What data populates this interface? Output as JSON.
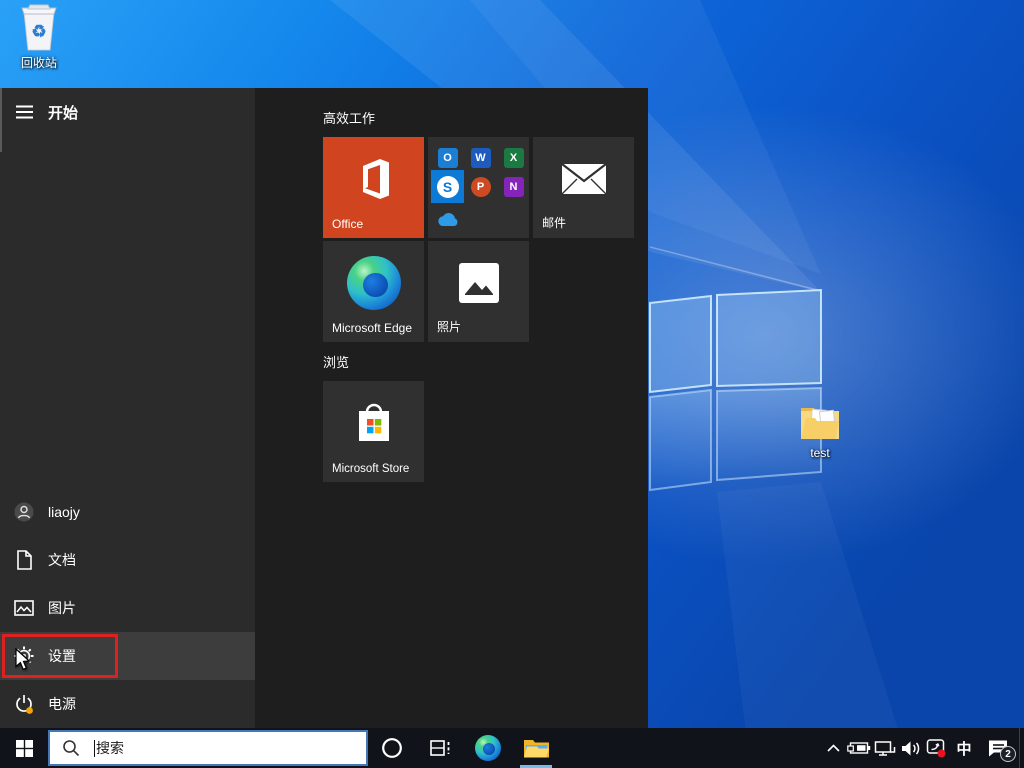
{
  "desktop": {
    "icons": [
      {
        "name": "recycle-bin",
        "label": "回收站"
      },
      {
        "name": "test-folder",
        "label": "test"
      }
    ]
  },
  "start_menu": {
    "header": {
      "menu_label": "开始"
    },
    "sidebar": [
      {
        "name": "user",
        "label": "liaojy"
      },
      {
        "name": "documents",
        "label": "文档"
      },
      {
        "name": "pictures",
        "label": "图片"
      },
      {
        "name": "settings",
        "label": "设置",
        "highlighted": true,
        "annotated": "red-box"
      },
      {
        "name": "power",
        "label": "电源",
        "update_dot": true
      }
    ],
    "groups": [
      {
        "title": "高效工作",
        "tiles": [
          {
            "name": "office",
            "label": "Office"
          },
          {
            "name": "office-apps",
            "label": ""
          },
          {
            "name": "mail",
            "label": "邮件"
          },
          {
            "name": "edge",
            "label": "Microsoft Edge"
          },
          {
            "name": "photos",
            "label": "照片"
          }
        ]
      },
      {
        "title": "浏览",
        "tiles": [
          {
            "name": "microsoft-store",
            "label": "Microsoft Store"
          }
        ]
      }
    ],
    "office_apps_letters": {
      "outlook": "O",
      "word": "W",
      "excel": "X",
      "skype": "S",
      "powerpoint": "P",
      "onenote": "N"
    }
  },
  "taskbar": {
    "search_placeholder": "搜索",
    "ime_indicator": "中",
    "notification_badge": "2"
  },
  "colors": {
    "office_tile_orange": "#d0441f",
    "skype_blue": "#0d7ad6",
    "ms_red": "#f25022",
    "ms_green": "#7fba00",
    "ms_blue": "#00a4ef",
    "ms_yellow": "#ffb900",
    "search_border_blue": "#4377b8",
    "running_app_underline": "#76b9ed",
    "annotation_red": "#e01f1f",
    "power_update_dot_orange": "#f7a500",
    "taskbar_background": "#10141a",
    "start_sidebar_background": "#2b2b2b",
    "start_tiles_background": "#1e1e1e"
  }
}
